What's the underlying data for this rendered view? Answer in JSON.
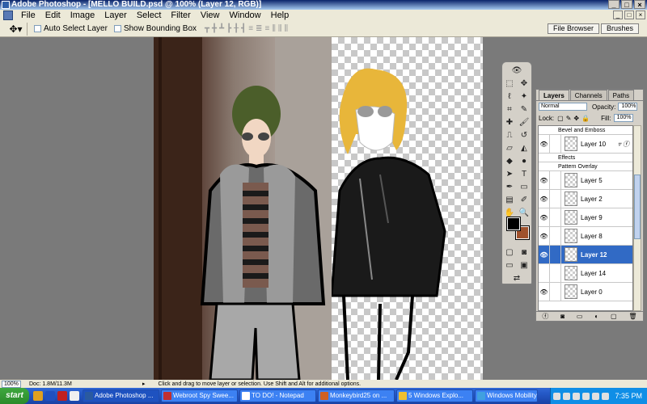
{
  "window": {
    "title": "Adobe Photoshop - [MELLO BUILD.psd @ 100% (Layer 12, RGB)]",
    "controls": [
      "_",
      "□",
      "×"
    ]
  },
  "menu": {
    "items": [
      "File",
      "Edit",
      "Image",
      "Layer",
      "Select",
      "Filter",
      "View",
      "Window",
      "Help"
    ],
    "doc_controls": [
      "_",
      "□",
      "×"
    ]
  },
  "options_bar": {
    "tool_icon": "move-tool-icon",
    "auto_select_layer": "Auto Select Layer",
    "show_bounding_box": "Show Bounding Box",
    "palette_well_tabs": [
      "File Browser",
      "Brushes"
    ]
  },
  "layers_palette": {
    "tabs": [
      "Layers",
      "Channels",
      "Paths"
    ],
    "blend_mode": "Normal",
    "opacity_label": "Opacity:",
    "opacity_value": "100%",
    "lock_label": "Lock:",
    "fill_label": "Fill:",
    "fill_value": "100%",
    "layers": [
      {
        "name": "Bevel and Emboss",
        "type": "effect"
      },
      {
        "name": "Layer 10",
        "type": "layer",
        "fx": true
      },
      {
        "name": "Effects",
        "type": "effect"
      },
      {
        "name": "Pattern Overlay",
        "type": "effect"
      },
      {
        "name": "Layer 5",
        "type": "layer"
      },
      {
        "name": "Layer 2",
        "type": "layer"
      },
      {
        "name": "Layer 9",
        "type": "layer"
      },
      {
        "name": "Layer 8",
        "type": "layer"
      },
      {
        "name": "Layer 12",
        "type": "layer",
        "selected": true
      },
      {
        "name": "Layer 14",
        "type": "layer"
      },
      {
        "name": "Layer 0",
        "type": "layer"
      }
    ]
  },
  "tools": {
    "foreground_color": "#000000",
    "background_color": "#a0522d"
  },
  "status_bar": {
    "zoom": "100%",
    "doc_info": "Doc: 1.8M/11.3M",
    "hint": "Click and drag to move layer or selection. Use Shift and Alt for additional options."
  },
  "taskbar": {
    "start_label": "start",
    "buttons": [
      {
        "label": "Adobe Photoshop ...",
        "active": true,
        "color": "#2a5aa0"
      },
      {
        "label": "Webroot Spy Swee...",
        "active": false,
        "color": "#c03030"
      },
      {
        "label": "TO DO! - Notepad",
        "active": false,
        "color": "#ffffff"
      },
      {
        "label": "Monkeybird25 on ...",
        "active": false,
        "color": "#d06020"
      },
      {
        "label": "5 Windows Explo...",
        "active": false,
        "color": "#f0c030"
      },
      {
        "label": "Windows Mobility ...",
        "active": false,
        "color": "#40a0e0"
      }
    ],
    "time": "7:35 PM"
  }
}
